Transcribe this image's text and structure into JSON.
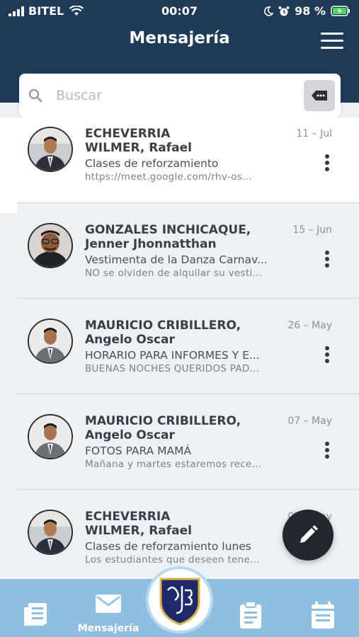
{
  "status_bar": {
    "carrier": "BITEL",
    "time": "00:07",
    "battery": "98 %"
  },
  "header": {
    "title": "Mensajería"
  },
  "search": {
    "placeholder": "Buscar"
  },
  "messages": [
    {
      "sender_line1": "ECHEVERRIA",
      "sender_line2": "WILMER, Rafael",
      "date": "11 – Jul",
      "subject": "Clases de reforzamiento",
      "preview": "https://meet.google.com/rhv-os..."
    },
    {
      "sender_line1": "GONZALES INCHICAQUE,",
      "sender_line2": "Jenner Jhonnatthan",
      "date": "15 – Jun",
      "subject": "Vestimenta de la Danza Carnav...",
      "preview": "NO se olviden de alquilar su vesti..."
    },
    {
      "sender_line1": "MAURICIO CRIBILLERO,",
      "sender_line2": "Angelo Oscar",
      "date": "26 – May",
      "subject": "HORARIO PARA INFORMES Y E...",
      "preview": "BUENAS NOCHES QUERIDOS PAD..."
    },
    {
      "sender_line1": "MAURICIO CRIBILLERO,",
      "sender_line2": "Angelo Oscar",
      "date": "07 – May",
      "subject": "FOTOS PARA MAMÁ",
      "preview": "Mañana y martes estaremos rece..."
    },
    {
      "sender_line1": "ECHEVERRIA",
      "sender_line2": "WILMER, Rafael",
      "date": "07 – May",
      "subject": "Clases de reforzamiento lunes",
      "preview": "Los estudiantes que deseen tene..."
    }
  ],
  "tabs": {
    "messaging_label": "Mensajería"
  },
  "colors": {
    "header": "#1e3a57",
    "tabbar": "#8ebfe0",
    "background": "#edf0f4",
    "fab": "#23272d"
  },
  "icons": [
    "search-icon",
    "tag-icon",
    "more-vert-icon",
    "pencil-icon",
    "news-icon",
    "mail-icon",
    "school-crest-icon",
    "clipboard-icon",
    "calendar-icon",
    "menu-icon"
  ]
}
